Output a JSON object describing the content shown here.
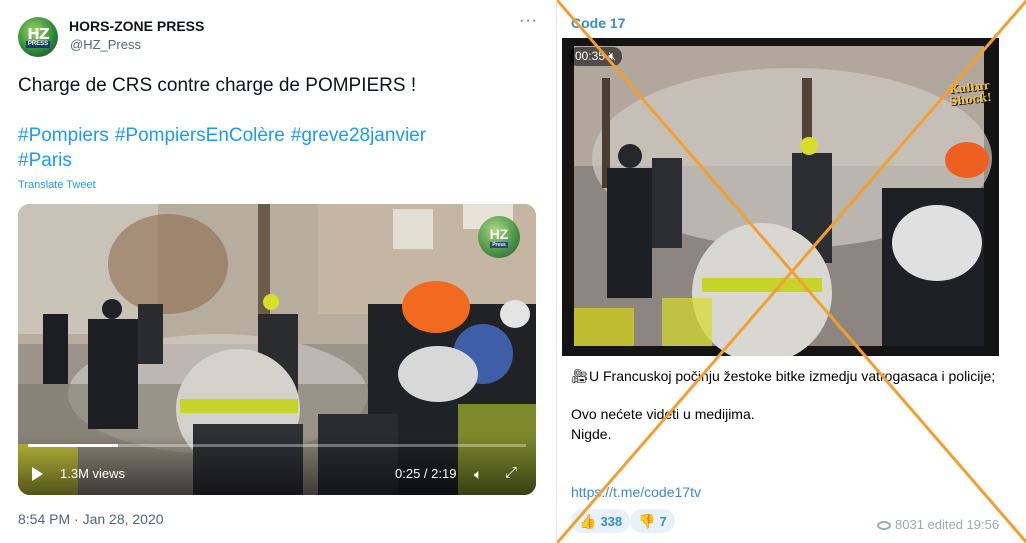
{
  "tweet": {
    "author_name": "HORS-ZONE PRESS",
    "handle": "@HZ_Press",
    "avatar_text": "HZ",
    "avatar_subtext": "PRESS",
    "more_label": "···",
    "text": "Charge de CRS contre charge de POMPIERS !",
    "hashtags": [
      "#Pompiers",
      "#PompiersEnColère",
      "#greve28janvier",
      "#Paris"
    ],
    "translate_label": "Translate Tweet",
    "video": {
      "views": "1.3M views",
      "timecode": "0:25 / 2:19",
      "progress": 0.18,
      "watermark": "HZ",
      "watermark_sub": "Press",
      "icons": [
        "play-icon",
        "volume-icon",
        "expand-icon"
      ]
    },
    "date": "8:54 PM · Jan 28, 2020"
  },
  "telegram_post": {
    "channel": "Code 17",
    "video": {
      "time": "00:35",
      "watermark": "Kultur Shock!",
      "icons": [
        "mute-icon"
      ]
    },
    "line1": "U Francuskoj počinju žestoke bitke izmedju vatrogasaca i policije;",
    "line2": "Ovo nećete videti u medijima.",
    "line3": "Nigde.",
    "link": "https://t.me/code17tv",
    "reactions": [
      {
        "emoji": "👍",
        "count": "338"
      },
      {
        "emoji": "👎",
        "count": "7"
      }
    ],
    "views": "8031",
    "edited": "edited 19:56"
  },
  "overlay": {
    "cross_color": "#f0a030"
  }
}
